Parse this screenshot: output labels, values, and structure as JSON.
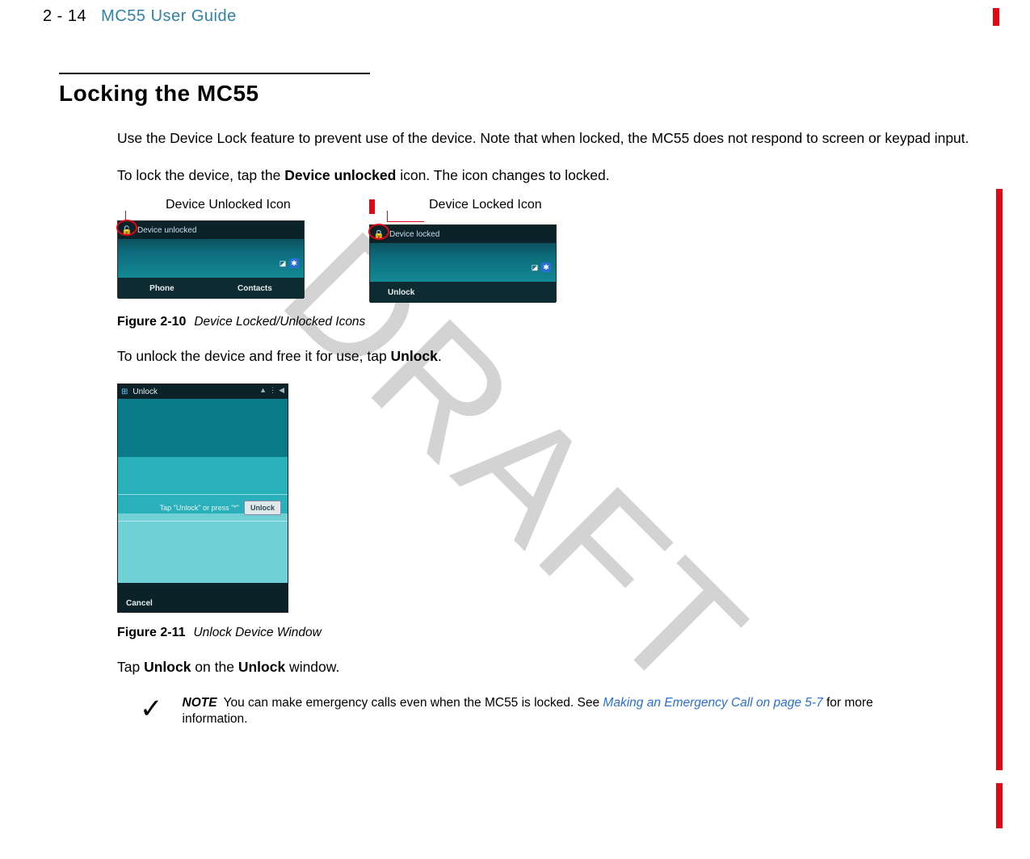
{
  "header": {
    "page_number": "2 - 14",
    "doc_title": "MC55 User Guide"
  },
  "section_title": "Locking the MC55",
  "para1": "Use the Device Lock feature to prevent use of the device. Note that when locked, the MC55 does not respond to screen or keypad input.",
  "para2_pre": "To lock the device, tap the ",
  "para2_bold": "Device unlocked",
  "para2_post": " icon. The icon changes to locked.",
  "callout_unlocked": "Device Unlocked Icon",
  "callout_locked": "Device Locked Icon",
  "ss_unlocked": {
    "label": "Device unlocked",
    "bottom_left": "Phone",
    "bottom_right": "Contacts"
  },
  "ss_locked": {
    "label": "Device locked",
    "bottom": "Unlock"
  },
  "fig10_num": "Figure 2-10",
  "fig10_caption": "Device Locked/Unlocked Icons",
  "para3_pre": "To unlock the device and free it for use, tap ",
  "para3_bold": "Unlock",
  "para3_post": ".",
  "unlock_window": {
    "title": "Unlock",
    "prompt": "Tap \"Unlock\" or press \"*\"",
    "button": "Unlock",
    "bottom": "Cancel"
  },
  "fig11_num": "Figure 2-11",
  "fig11_caption": "Unlock Device Window",
  "para4_pre": "Tap ",
  "para4_b1": "Unlock",
  "para4_mid": " on the ",
  "para4_b2": "Unlock",
  "para4_post": " window.",
  "note_label": "NOTE",
  "note_text_pre": "You can make emergency calls even when the MC55 is locked. See ",
  "note_link": "Making an Emergency Call on page 5-7",
  "note_text_post": " for more information.",
  "watermark": "DRAFT"
}
